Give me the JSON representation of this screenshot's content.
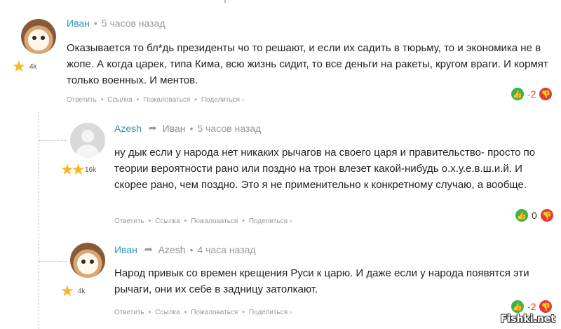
{
  "comments": [
    {
      "author": "Иван",
      "time": "5 часов назад",
      "karma": "4k",
      "text": "Оказывается то бл*дь президенты чо то решают, и если их садить в тюрьму, то и экономика не в жопе. А когда царек, типа Кима, всю жизнь сидит, то все деньги на ракеты, кругом враги. И кормят только военных. И ментов.",
      "score": "-2",
      "stars": 1
    },
    {
      "author": "Azesh",
      "reply_to": "Иван",
      "time": "5 часов назад",
      "karma": "16k",
      "text": "ну дык если у народа нет никаких рычагов на своего царя и правительство- просто по теории вероятности рано или поздно на трон влезет какой-нибудь о.х.у.е.в.ш.и.й. И скорее рано, чем поздно. Это я не применительно к конкретному случаю, а вообще.",
      "score": "0",
      "stars": 2
    },
    {
      "author": "Иван",
      "reply_to": "Azesh",
      "time": "4 часа назад",
      "karma": "4k",
      "text": "Народ привык со времен крещения Руси к царю. И даже если у народа появятся эти рычаги, они их себе в задницу затолкают.",
      "score": "-2",
      "stars": 1
    }
  ],
  "actions": {
    "reply": "Ответить",
    "link": "Ссылка",
    "report": "Пожаловаться",
    "share": "Поделиться ›",
    "bullet": "•"
  },
  "watermark": "Fishki.net",
  "colors": {
    "author": "#2c96b4",
    "upvote": "#3cb34a",
    "downvote": "#e23b3b",
    "star": "#f5b81f"
  },
  "icons": [
    "star-icon",
    "thumbs-up-icon",
    "thumbs-down-icon",
    "reply-arrow-icon",
    "user-placeholder-icon"
  ]
}
